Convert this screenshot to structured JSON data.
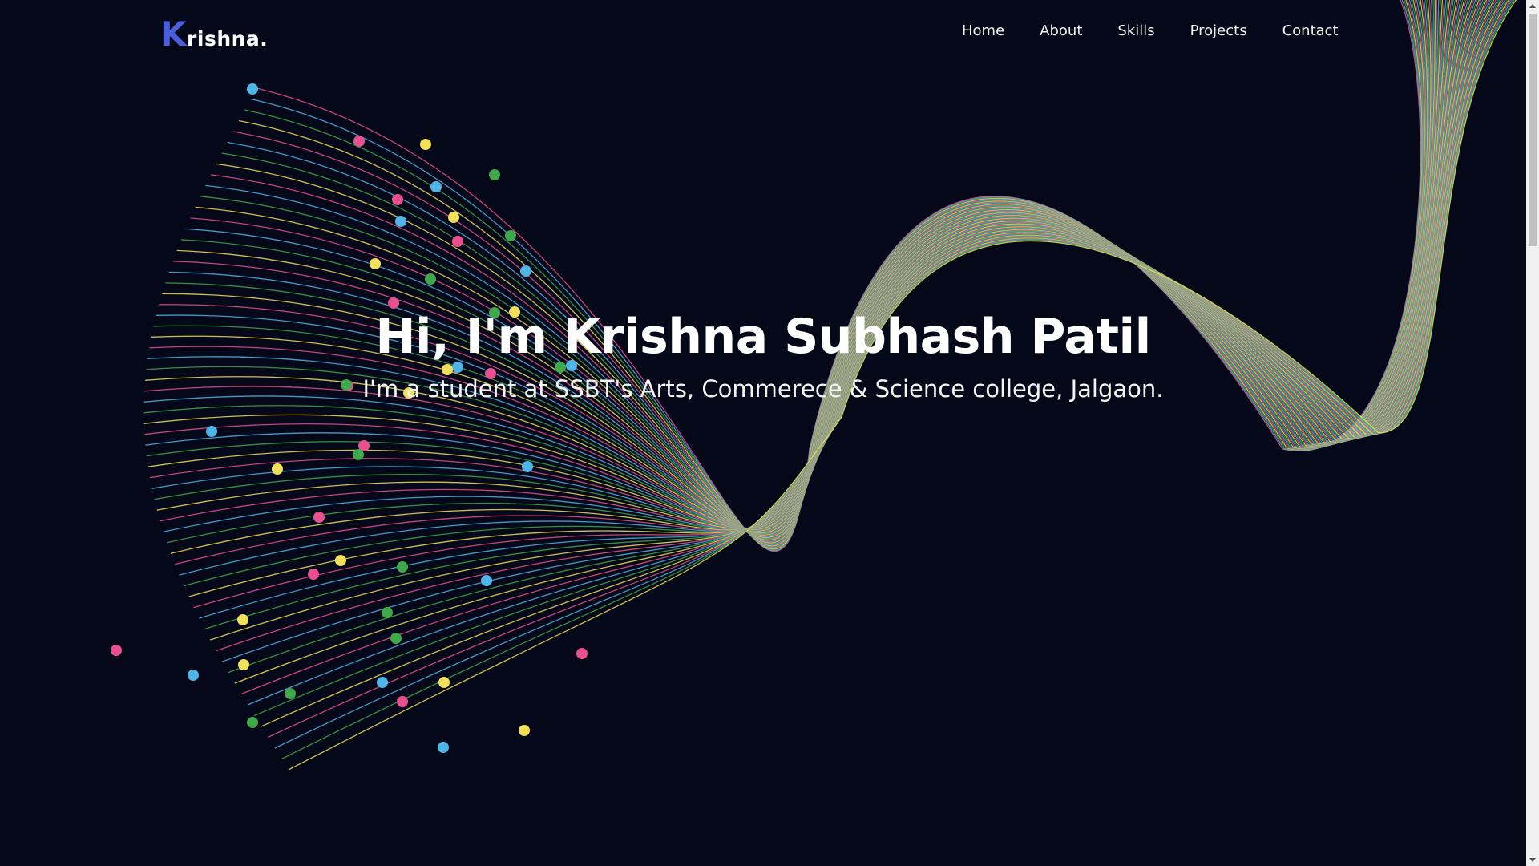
{
  "header": {
    "logo_initial": "K",
    "logo_rest": "rishna."
  },
  "nav": {
    "items": [
      {
        "label": "Home"
      },
      {
        "label": "About"
      },
      {
        "label": "Skills"
      },
      {
        "label": "Projects"
      },
      {
        "label": "Contact"
      }
    ]
  },
  "hero": {
    "title": "Hi, I'm Krishna Subhash Patil",
    "subtitle": "I'm a student at SSBT's Arts, Commerece & Science college, Jalgaon."
  },
  "colors": {
    "background": "#040818",
    "logo_accent": "#4a5fd9",
    "text": "#ffffff",
    "wave_pink": "#e8508f",
    "wave_blue": "#4fb4e6",
    "wave_green": "#3fa84a",
    "wave_yellow": "#f3e05a"
  }
}
